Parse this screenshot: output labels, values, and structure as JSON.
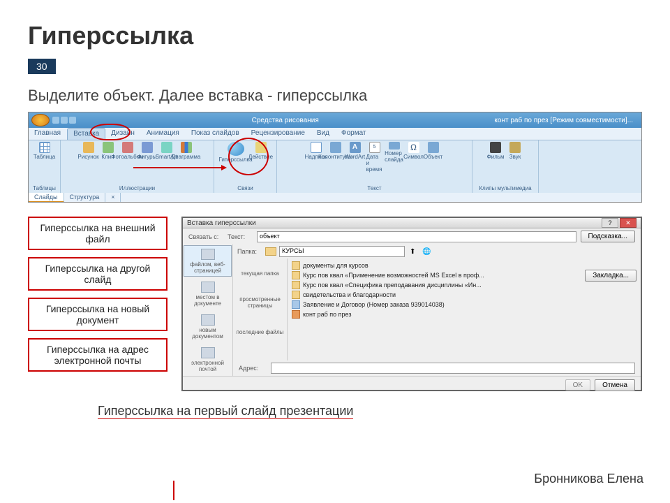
{
  "slide": {
    "title": "Гиперссылка",
    "page_number": "30",
    "subtitle": "Выделите объект. Далее вставка - гиперссылка",
    "footer_link": "Гиперссылка на первый слайд презентации",
    "author": "Бронникова Елена"
  },
  "ribbon": {
    "doc_section_title": "Средства рисования",
    "doc_title": "конт раб по през [Режим совместимости]...",
    "tabs": [
      "Главная",
      "Вставка",
      "Дизайн",
      "Анимация",
      "Показ слайдов",
      "Рецензирование",
      "Вид",
      "Формат"
    ],
    "active_tab": "Вставка",
    "groups": {
      "tables": {
        "label": "Таблицы",
        "items": [
          "Таблица"
        ]
      },
      "illustrations": {
        "label": "Иллюстрации",
        "items": [
          "Рисунок",
          "Клип",
          "Фотоальбом",
          "Фигуры",
          "SmartArt",
          "Диаграмма"
        ]
      },
      "links": {
        "label": "Связи",
        "items": [
          "Гиперссылка",
          "Действие"
        ]
      },
      "text": {
        "label": "Текст",
        "items": [
          "Надпись",
          "Колонтитулы",
          "WordArt",
          "Дата и время",
          "Номер слайда",
          "Символ",
          "Объект"
        ]
      },
      "media": {
        "label": "Клипы мультимедиа",
        "items": [
          "Фильм",
          "Звук"
        ]
      }
    },
    "bottom_tabs": [
      "Слайды",
      "Структура"
    ]
  },
  "callouts": [
    "Гиперссылка на внешний файл",
    "Гиперссылка на другой слайд",
    "Гиперссылка на новый документ",
    "Гиперссылка на адрес электронной почты"
  ],
  "dialog": {
    "title": "Вставка гиперссылки",
    "link_to_label": "Связать с:",
    "text_label": "Текст:",
    "text_value": "объект",
    "hint_btn": "Подсказка...",
    "bookmark_btn": "Закладка...",
    "folder_label": "Папка:",
    "folder_value": "КУРСЫ",
    "address_label": "Адрес:",
    "ok": "OK",
    "cancel": "Отмена",
    "side_items": [
      "файлом, веб-страницей",
      "местом в документе",
      "новым документом",
      "электронной почтой"
    ],
    "mid_items": [
      "текущая папка",
      "просмотренные страницы",
      "последние файлы"
    ],
    "files": [
      "документы для курсов",
      "Курс пов квал «Применение возможностей MS Excel в проф...",
      "Курс пов квал «Специфика преподавания дисциплины «Ин...",
      "свидетельства и благодарности",
      "Заявление и Договор (Номер заказа 939014038)",
      "конт раб по през"
    ]
  }
}
